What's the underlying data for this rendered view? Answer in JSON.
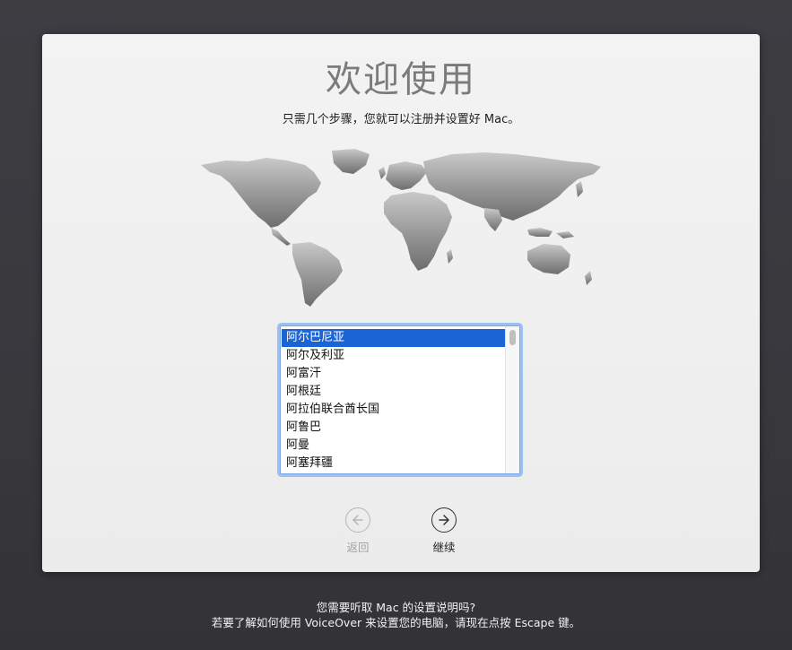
{
  "welcome": {
    "title": "欢迎使用",
    "subtitle": "只需几个步骤，您就可以注册并设置好 Mac。"
  },
  "country_list": {
    "items": [
      "阿尔巴尼亚",
      "阿尔及利亚",
      "阿富汗",
      "阿根廷",
      "阿拉伯联合酋长国",
      "阿鲁巴",
      "阿曼",
      "阿塞拜疆"
    ],
    "selected": "阿尔巴尼亚"
  },
  "navigation": {
    "back_label": "返回",
    "continue_label": "继续",
    "back_icon": "arrow-left-circle-icon",
    "continue_icon": "arrow-right-circle-icon"
  },
  "footer": {
    "line1": "您需要听取 Mac 的设置说明吗?",
    "line2": "若要了解如何使用 VoiceOver 来设置您的电脑，请现在点按 Escape 键。"
  },
  "colors": {
    "selection": "#1b64d6",
    "focus_ring": "#9cc0f0",
    "background": "#3a3a3f",
    "panel": "#efefef"
  }
}
